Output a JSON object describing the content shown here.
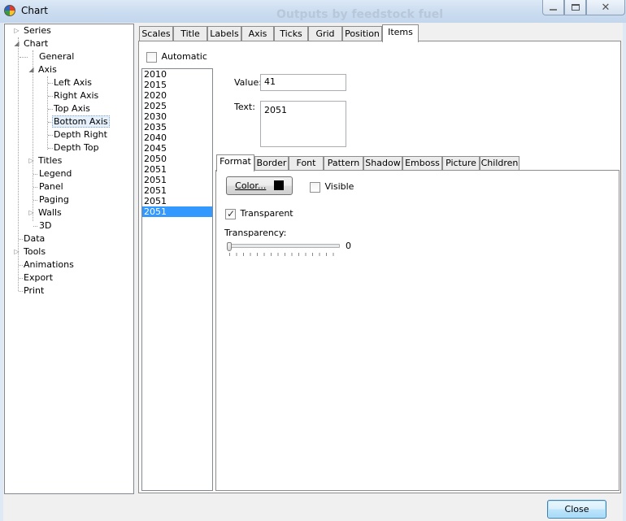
{
  "window": {
    "title": "Chart",
    "background_text": "Outputs by feedstock fuel"
  },
  "tree": {
    "series": "Series",
    "chart": "Chart",
    "general": "General",
    "axis": "Axis",
    "left_axis": "Left Axis",
    "right_axis": "Right Axis",
    "top_axis": "Top Axis",
    "bottom_axis": "Bottom Axis",
    "depth_right": "Depth Right",
    "depth_top": "Depth Top",
    "titles": "Titles",
    "legend": "Legend",
    "panel": "Panel",
    "paging": "Paging",
    "walls": "Walls",
    "three_d": "3D",
    "data": "Data",
    "tools": "Tools",
    "animations": "Animations",
    "export": "Export",
    "print": "Print",
    "selected": "Bottom Axis"
  },
  "tabs": [
    "Scales",
    "Title",
    "Labels",
    "Axis",
    "Ticks",
    "Grid",
    "Position",
    "Items"
  ],
  "active_tab": "Items",
  "items": {
    "automatic_label": "Automatic",
    "automatic_checked": false,
    "list": [
      "2010",
      "2015",
      "2020",
      "2025",
      "2030",
      "2035",
      "2040",
      "2045",
      "2050",
      "2051",
      "2051",
      "2051",
      "2051",
      "2051"
    ],
    "selected_index": 13,
    "value_label": "Value:",
    "value": "41",
    "text_label": "Text:",
    "text": "2051"
  },
  "subtabs": [
    "Format",
    "Border",
    "Font",
    "Pattern",
    "Shadow",
    "Emboss",
    "Picture",
    "Children"
  ],
  "active_subtab": "Format",
  "format": {
    "color_button": "Color...",
    "color_swatch": "#000000",
    "visible_label": "Visible",
    "visible_checked": false,
    "transparent_label": "Transparent",
    "transparent_checked": true,
    "transparency_label": "Transparency:",
    "transparency_value": "0",
    "transparency_fraction": 0
  },
  "footer": {
    "close_button": "Close"
  },
  "colors": {
    "selection": "#3399ff",
    "titlebar": "#c9dbef"
  },
  "icons": {
    "app": "chart-app-icon",
    "minimize": "minimize-icon",
    "restore": "restore-icon",
    "close": "close-icon"
  }
}
